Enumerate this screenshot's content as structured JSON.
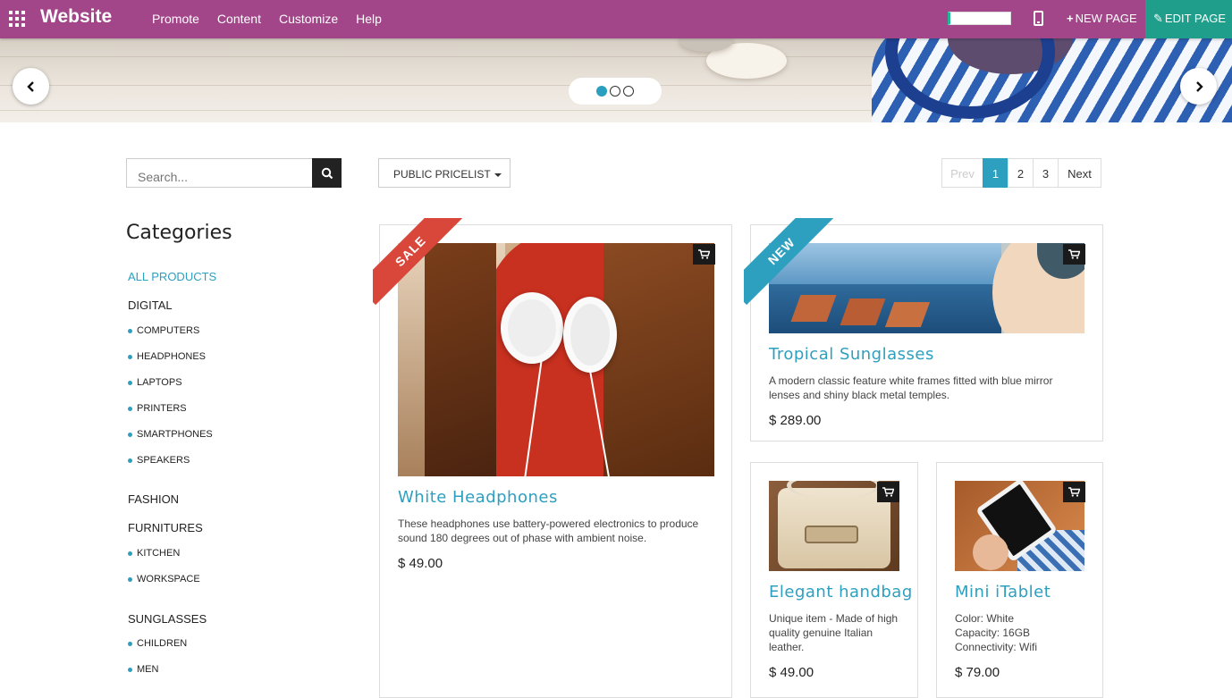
{
  "topbar": {
    "brand": "Website",
    "menu": [
      "Promote",
      "Content",
      "Customize",
      "Help"
    ],
    "new_page": "NEW PAGE",
    "edit_page": "EDIT PAGE",
    "accent": "#a24689",
    "edit_color": "#1f9f8b"
  },
  "banner": {
    "slides": 3,
    "active_slide": 1
  },
  "search": {
    "placeholder": "Search..."
  },
  "pricelist": {
    "label": "PUBLIC PRICELIST"
  },
  "pager": {
    "prev": "Prev",
    "pages": [
      "1",
      "2",
      "3"
    ],
    "active": "1",
    "next": "Next"
  },
  "categories": {
    "title": "Categories",
    "all": "ALL PRODUCTS",
    "digital": "DIGITAL",
    "digital_sub": [
      "COMPUTERS",
      "HEADPHONES",
      "LAPTOPS",
      "PRINTERS",
      "SMARTPHONES",
      "SPEAKERS"
    ],
    "fashion": "FASHION",
    "furnitures": "FURNITURES",
    "furnitures_sub": [
      "KITCHEN",
      "WORKSPACE"
    ],
    "sunglasses": "SUNGLASSES",
    "sunglasses_sub": [
      "CHILDREN",
      "MEN"
    ]
  },
  "products": [
    {
      "name": "White Headphones",
      "description": "These headphones use battery-powered electronics to produce sound 180 degrees out of phase with ambient noise.",
      "price": "$ 49.00",
      "ribbon": "SALE"
    },
    {
      "name": "Tropical Sunglasses",
      "description": "A modern classic feature white frames fitted with blue mirror lenses and shiny black metal temples.",
      "price": "$ 289.00",
      "ribbon": "NEW"
    },
    {
      "name": "Elegant handbag",
      "description": "Unique item - Made of high quality genuine Italian leather.",
      "price": "$ 49.00"
    },
    {
      "name": "Mini iTablet",
      "description_lines": [
        "Color: White",
        "Capacity: 16GB",
        "Connectivity: Wifi"
      ],
      "price": "$ 79.00"
    }
  ],
  "icons": [
    "apps-icon",
    "mobile-icon",
    "plus-icon",
    "pencil-icon",
    "chevron-left-icon",
    "chevron-right-icon",
    "search-icon",
    "cart-icon",
    "caret-down-icon"
  ]
}
